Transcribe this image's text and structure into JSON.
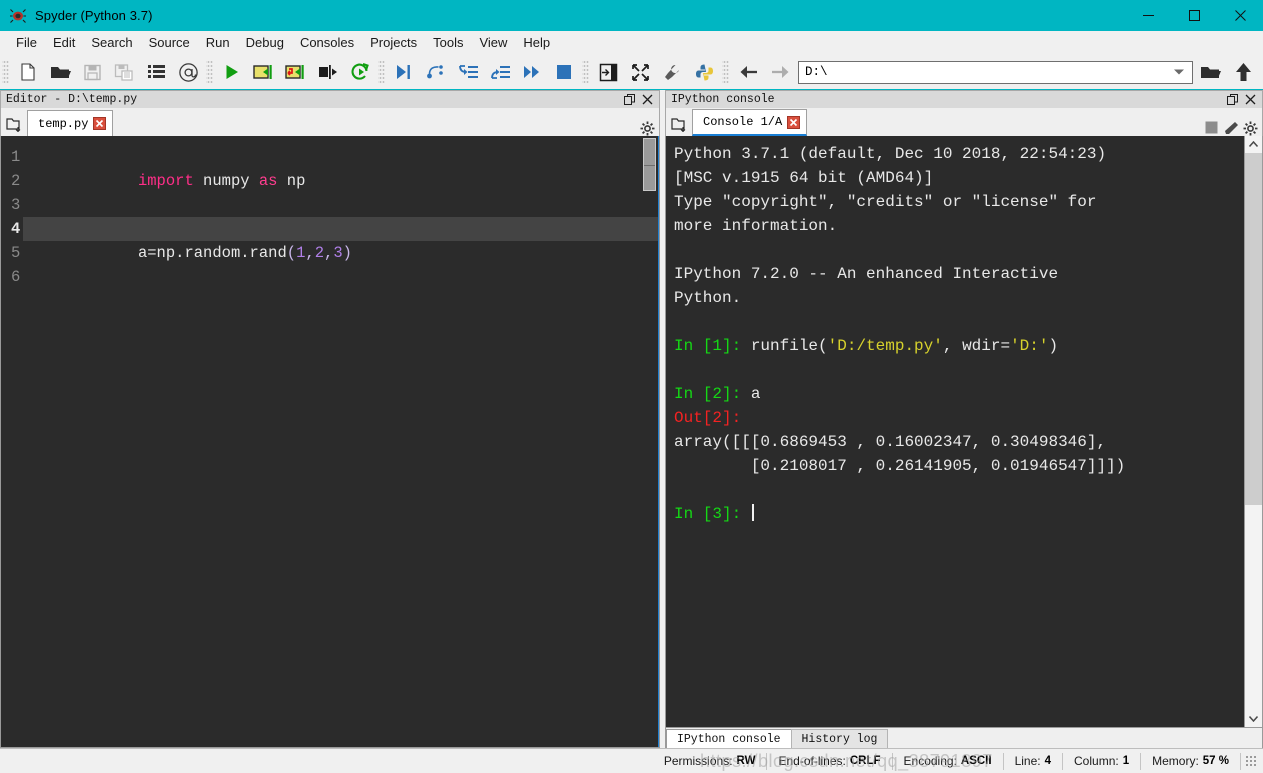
{
  "window": {
    "title": "Spyder (Python 3.7)",
    "icon": "spyder-icon",
    "accent_color": "#00b6c2",
    "controls": {
      "minimize": "minimize-icon",
      "maximize": "maximize-icon",
      "close": "close-icon"
    }
  },
  "menubar": {
    "items": [
      {
        "label": "File"
      },
      {
        "label": "Edit"
      },
      {
        "label": "Search"
      },
      {
        "label": "Source"
      },
      {
        "label": "Run"
      },
      {
        "label": "Debug"
      },
      {
        "label": "Consoles"
      },
      {
        "label": "Projects"
      },
      {
        "label": "Tools"
      },
      {
        "label": "View"
      },
      {
        "label": "Help"
      }
    ]
  },
  "toolbar": {
    "group_file": [
      {
        "name": "new-file-icon"
      },
      {
        "name": "open-file-icon"
      },
      {
        "name": "save-file-icon"
      },
      {
        "name": "save-all-icon"
      },
      {
        "name": "file-switcher-icon"
      },
      {
        "name": "find-symbol-icon"
      }
    ],
    "group_run": [
      {
        "name": "run-file-icon"
      },
      {
        "name": "run-cell-icon"
      },
      {
        "name": "run-cell-advance-icon"
      },
      {
        "name": "run-selection-icon"
      },
      {
        "name": "rerun-icon"
      }
    ],
    "group_debug": [
      {
        "name": "debug-file-icon"
      },
      {
        "name": "step-over-icon"
      },
      {
        "name": "step-into-icon"
      },
      {
        "name": "step-return-icon"
      },
      {
        "name": "continue-icon"
      },
      {
        "name": "stop-debug-icon"
      }
    ],
    "group_tools": [
      {
        "name": "maximize-pane-icon"
      },
      {
        "name": "fullscreen-icon"
      },
      {
        "name": "preferences-icon"
      },
      {
        "name": "python-path-icon"
      }
    ],
    "group_nav": [
      {
        "name": "back-icon"
      },
      {
        "name": "forward-icon"
      }
    ],
    "path": {
      "value": "D:\\",
      "placeholder": "",
      "dropdown_icon": "chevron-down-icon",
      "browse_icon": "browse-folder-icon",
      "parent_icon": "parent-directory-icon"
    }
  },
  "editor": {
    "pane_title": "Editor - D:\\temp.py",
    "undock_icon": "undock-icon",
    "close_icon": "close-pane-icon",
    "browse_tabs_icon": "browse-tabs-icon",
    "options_icon": "gear-icon",
    "tab": {
      "label": "temp.py",
      "close_icon": "close-tab-icon"
    },
    "line_numbers": [
      "1",
      "2",
      "3",
      "4",
      "5",
      "6"
    ],
    "current_line": 4,
    "lines": [
      {
        "n": 1,
        "tokens": [
          {
            "t": "import",
            "c": "kw"
          },
          {
            "t": " numpy ",
            "c": "plain"
          },
          {
            "t": "as",
            "c": "kw2"
          },
          {
            "t": " np",
            "c": "plain"
          }
        ]
      },
      {
        "n": 2,
        "tokens": []
      },
      {
        "n": 3,
        "tokens": []
      },
      {
        "n": 4,
        "tokens": [
          {
            "t": "a=np.random.rand",
            "c": "plain"
          },
          {
            "t": "(",
            "c": "paren"
          },
          {
            "t": "1",
            "c": "num"
          },
          {
            "t": ",",
            "c": "paren"
          },
          {
            "t": "2",
            "c": "num"
          },
          {
            "t": ",",
            "c": "paren"
          },
          {
            "t": "3",
            "c": "num"
          },
          {
            "t": ")",
            "c": "paren"
          }
        ]
      },
      {
        "n": 5,
        "tokens": []
      },
      {
        "n": 6,
        "tokens": []
      }
    ]
  },
  "console": {
    "pane_title": "IPython console",
    "undock_icon": "undock-icon",
    "close_icon": "close-pane-icon",
    "browse_tabs_icon": "browse-tabs-icon",
    "tab": {
      "label": "Console 1/A",
      "close_icon": "close-tab-icon"
    },
    "actions": [
      {
        "name": "interrupt-kernel-icon"
      },
      {
        "name": "remove-all-variables-icon"
      },
      {
        "name": "gear-icon"
      }
    ],
    "output": [
      {
        "cls": "white",
        "text": "Python 3.7.1 (default, Dec 10 2018, 22:54:23)"
      },
      {
        "cls": "white",
        "text": "[MSC v.1915 64 bit (AMD64)]"
      },
      {
        "cls": "white",
        "text": "Type \"copyright\", \"credits\" or \"license\" for"
      },
      {
        "cls": "white",
        "text": "more information."
      },
      {
        "cls": "white",
        "text": ""
      },
      {
        "cls": "white",
        "text": "IPython 7.2.0 -- An enhanced Interactive"
      },
      {
        "cls": "white",
        "text": "Python."
      },
      {
        "cls": "white",
        "text": ""
      }
    ],
    "prompt_1": {
      "prompt": "In [1]:",
      "code_plain_a": " runfile(",
      "code_str_a": "'D:/temp.py'",
      "code_plain_b": ", wdir=",
      "code_str_b": "'D:'",
      "code_plain_c": ")"
    },
    "blank_1": "",
    "prompt_2": {
      "prompt": "In [2]:",
      "code": " a"
    },
    "out_2_label": "Out[2]:",
    "out_2_lines": [
      "array([[[0.6869453 , 0.16002347, 0.30498346],",
      "        [0.2108017 , 0.26141905, 0.01946547]]])"
    ],
    "blank_2": "",
    "prompt_3": {
      "prompt": "In [3]:",
      "code": " "
    },
    "bottom_tabs": [
      {
        "label": "IPython console",
        "active": true
      },
      {
        "label": "History log",
        "active": false
      }
    ],
    "scroll_up_icon": "scroll-up-arrow-icon",
    "scroll_down_icon": "scroll-down-arrow-icon"
  },
  "statusbar": {
    "items": [
      {
        "label": "Permissions:",
        "value": "RW"
      },
      {
        "label": "End-of-lines:",
        "value": "CRLF"
      },
      {
        "label": "Encoding:",
        "value": "ASCII"
      },
      {
        "label": "Line:",
        "value": "4"
      },
      {
        "label": "Column:",
        "value": "1"
      },
      {
        "label": "Memory:",
        "value": "57 %"
      }
    ],
    "watermark": "https://blog.csdn.net/qq_38791897"
  }
}
